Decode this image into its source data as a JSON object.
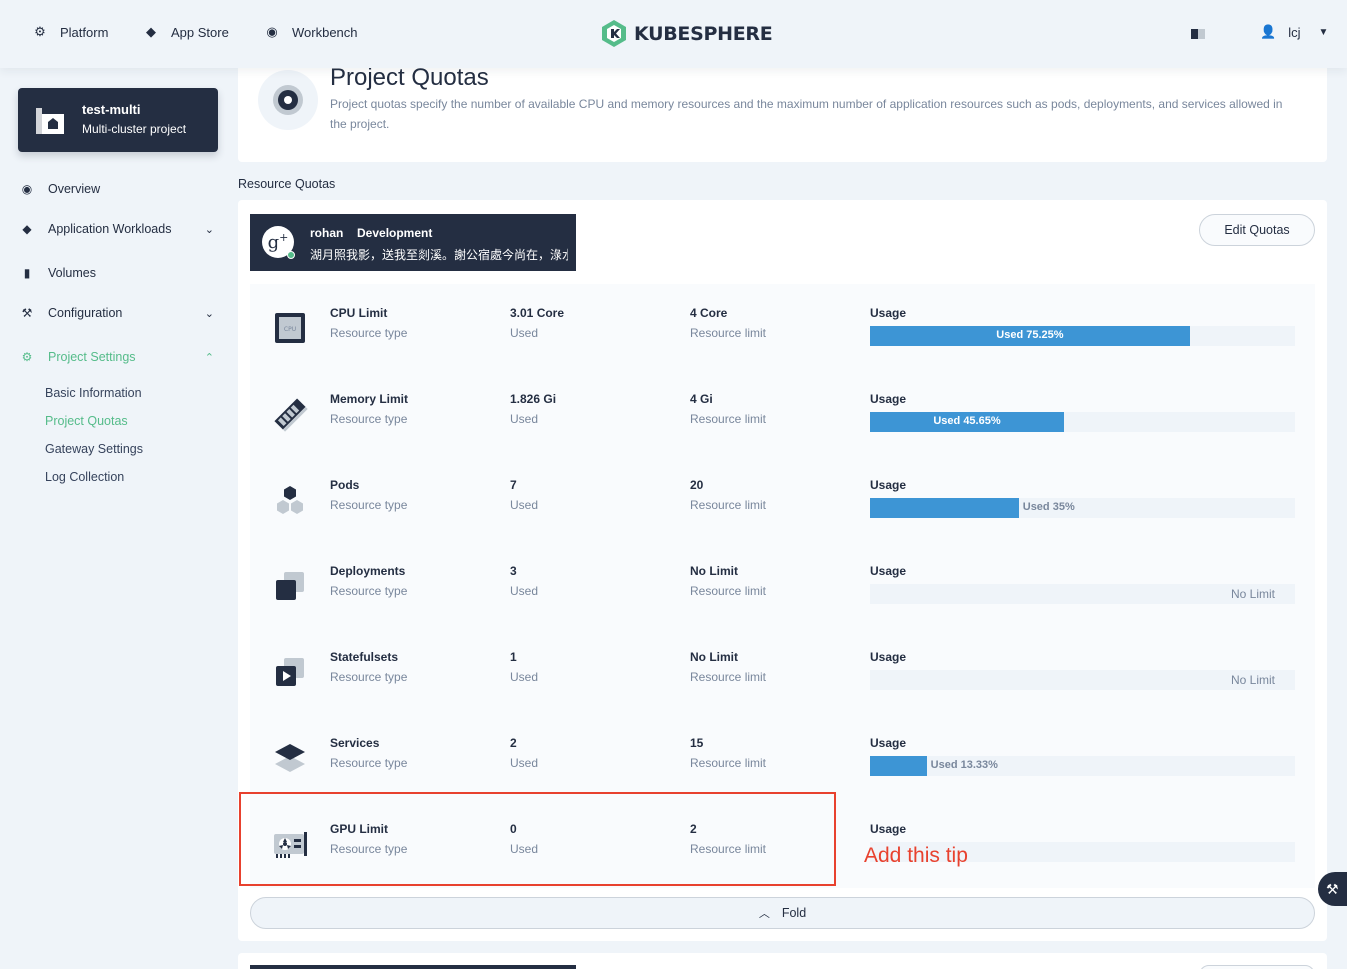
{
  "topnav": {
    "items": [
      {
        "label": "Platform",
        "icon": "gear-icon"
      },
      {
        "label": "App Store",
        "icon": "layers-icon"
      },
      {
        "label": "Workbench",
        "icon": "dashboard-icon"
      }
    ],
    "logo_text": "KUBESPHERE",
    "user_name": "lcj"
  },
  "project": {
    "name": "test-multi",
    "description": "Multi-cluster project"
  },
  "sidebar": {
    "items": [
      {
        "label": "Overview",
        "icon": "dashboard-icon"
      },
      {
        "label": "Application Workloads",
        "icon": "layers-icon"
      },
      {
        "label": "Volumes",
        "icon": "database-icon"
      },
      {
        "label": "Configuration",
        "icon": "hammer-icon"
      },
      {
        "label": "Project Settings",
        "icon": "gear-icon"
      }
    ],
    "subitems": [
      {
        "label": "Basic Information"
      },
      {
        "label": "Project Quotas"
      },
      {
        "label": "Gateway Settings"
      },
      {
        "label": "Log Collection"
      }
    ]
  },
  "page": {
    "title": "Project Quotas",
    "description": "Project quotas specify the number of available CPU and memory resources and the maximum number of application resources such as pods, deployments, and services allowed in the project."
  },
  "section_title": "Resource Quotas",
  "cluster": {
    "name": "rohan",
    "env": "Development",
    "description": "湖月照我影，送我至剡溪。謝公宿處今尚在，淥水蕩漾清猿啼。",
    "edit_label": "Edit Quotas"
  },
  "columns": {
    "type_label": "Resource type",
    "used_label": "Used",
    "limit_label": "Resource limit",
    "usage_label": "Usage",
    "no_limit_label": "No Limit"
  },
  "quotas": [
    {
      "name": "CPU Limit",
      "used": "3.01 Core",
      "limit": "4 Core",
      "percent": 75.25,
      "bar_text": "Used 75.25%",
      "icon": "cpu-icon"
    },
    {
      "name": "Memory Limit",
      "used": "1.826 Gi",
      "limit": "4 Gi",
      "percent": 45.65,
      "bar_text": "Used 45.65%",
      "icon": "memory-icon"
    },
    {
      "name": "Pods",
      "used": "7",
      "limit": "20",
      "percent": 35,
      "bar_text": "Used 35%",
      "icon": "pods-icon"
    },
    {
      "name": "Deployments",
      "used": "3",
      "limit": "No Limit",
      "percent": null,
      "bar_text": "No Limit",
      "icon": "deployments-icon"
    },
    {
      "name": "Statefulsets",
      "used": "1",
      "limit": "No Limit",
      "percent": null,
      "bar_text": "No Limit",
      "icon": "statefulsets-icon"
    },
    {
      "name": "Services",
      "used": "2",
      "limit": "15",
      "percent": 13.33,
      "bar_text": "Used 13.33%",
      "icon": "services-icon"
    },
    {
      "name": "GPU Limit",
      "used": "0",
      "limit": "2",
      "percent": 0,
      "bar_text": "",
      "icon": "gpu-icon"
    }
  ],
  "fold_label": "Fold",
  "annotation": {
    "tip": "Add this tip",
    "color": "#e8412e"
  },
  "colors": {
    "accent_green": "#55bc8a",
    "bar_blue": "#3d95d5",
    "dark": "#242e42"
  }
}
